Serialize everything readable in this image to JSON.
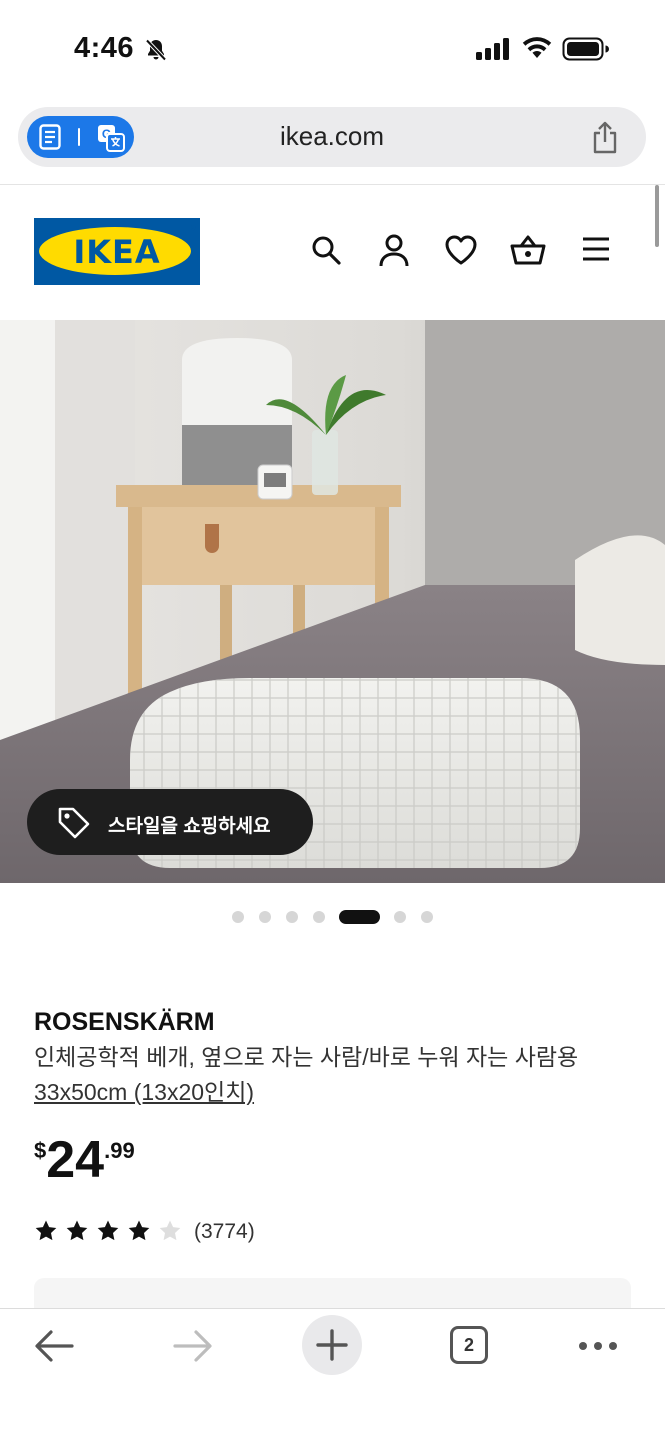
{
  "status_bar": {
    "time": "4:46"
  },
  "browser": {
    "url": "ikea.com",
    "open_tabs": "2"
  },
  "brand": {
    "logo_text": "IKEA",
    "registered": "®"
  },
  "promo": {
    "shop_style_label": "스타일을 쇼핑하세요"
  },
  "carousel": {
    "total_slides": 7,
    "active_index": 4
  },
  "product": {
    "name": "ROSENSKÄRM",
    "description": "인체공학적 베개, 옆으로 자는 사람/바로 누워 자는 사람용",
    "size": "33x50cm (13x20인치)",
    "price_currency": "$",
    "price_integer": "24",
    "price_decimal": ".99",
    "rating_value": 4,
    "rating_max": 5,
    "review_count": "(3774)"
  },
  "colors": {
    "ikea_blue": "#0058a3",
    "ikea_yellow": "#ffdb00",
    "safari_blue": "#1c78e8"
  },
  "icons": [
    "bell-slash-icon",
    "signal-icon",
    "wifi-icon",
    "battery-icon",
    "reader-icon",
    "translate-icon",
    "share-icon",
    "search-icon",
    "account-icon",
    "heart-icon",
    "basket-icon",
    "menu-icon",
    "tag-icon",
    "star-icon",
    "back-arrow-icon",
    "forward-arrow-icon",
    "plus-icon",
    "tabs-icon",
    "more-icon"
  ]
}
